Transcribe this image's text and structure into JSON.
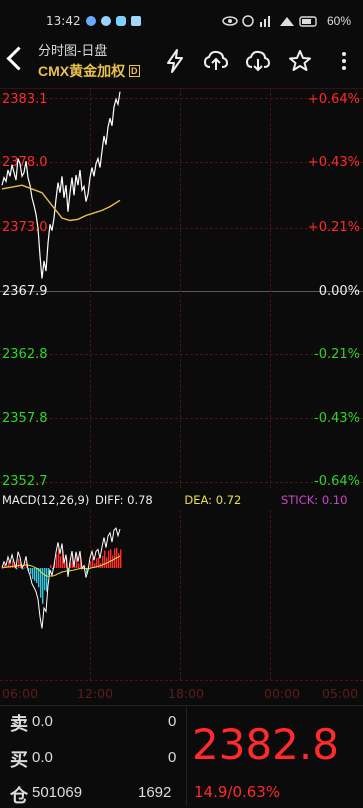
{
  "status_bar": {
    "time": "13:42",
    "battery": "60%",
    "icons": [
      "notification-icon",
      "qq-icon",
      "chat-icon",
      "shield-icon",
      "eye-icon",
      "alarm-icon",
      "signal-icon",
      "wifi-icon",
      "battery-icon"
    ]
  },
  "header": {
    "title_line1": "分时图-日盘",
    "title_line2": "CMX黄金加权",
    "title_badge": "D",
    "icons": [
      "lightning-icon",
      "cloud-upload-icon",
      "cloud-download-icon",
      "star-icon",
      "more-icon"
    ]
  },
  "price_axis": {
    "left": [
      "2383.1",
      "2378.0",
      "2373.0",
      "2367.9",
      "2362.8",
      "2357.8",
      "2352.7"
    ],
    "right": [
      "+0.64%",
      "+0.43%",
      "+0.21%",
      "0.00%",
      "-0.21%",
      "-0.43%",
      "-0.64%"
    ]
  },
  "macd": {
    "label": "MACD(12,26,9)",
    "diff_label": "DIFF:",
    "diff": "0.78",
    "dea_label": "DEA:",
    "dea": "0.72",
    "stick_label": "STICK:",
    "stick": "0.10"
  },
  "time_axis": [
    "06:00",
    "12:00",
    "18:00",
    "00:00",
    "05:00"
  ],
  "quote": {
    "sell_label": "卖",
    "sell_price": "0.0",
    "sell_volume": "0",
    "buy_label": "买",
    "buy_price": "0.0",
    "buy_volume": "0",
    "position_label": "仓",
    "position": "501069",
    "volume": "1692",
    "last_price": "2382.8",
    "change": "14.9/0.63%"
  },
  "colors": {
    "up": "#ff2a2a",
    "down": "#2cd52c",
    "avg_line": "#e9c24b",
    "price_line": "#ffffff",
    "dea": "#e9e24b",
    "stick": "#cc44cc",
    "macd_neg": "#35c8e0"
  },
  "chart_data": {
    "type": "line",
    "y_range": [
      2352.7,
      2383.1
    ],
    "reference_price": 2367.9,
    "series": [
      {
        "x": [
          0,
          1,
          2,
          3,
          4,
          5,
          6,
          7,
          8,
          9,
          10,
          11,
          12,
          13,
          14,
          15,
          16,
          17,
          18,
          19,
          20,
          21,
          22,
          23,
          24,
          25,
          26,
          27,
          28,
          29,
          30,
          31,
          32,
          33,
          34,
          35,
          36,
          37,
          38,
          39,
          40,
          41,
          42,
          43,
          44,
          45,
          46,
          47,
          48,
          49,
          50,
          51,
          52,
          53,
          54,
          55,
          56,
          57,
          58,
          59
        ],
        "values": [
          2376.2,
          2376.8,
          2376.5,
          2377.4,
          2376.9,
          2377.8,
          2377.2,
          2376.6,
          2378.3,
          2377.9,
          2376.9,
          2377.2,
          2378.1,
          2376.8,
          2376.2,
          2375.2,
          2374.6,
          2373.9,
          2372.8,
          2370.6,
          2368.8,
          2370.2,
          2369.4,
          2371.6,
          2373.1,
          2372.6,
          2373.6,
          2375.1,
          2376.4,
          2375.6,
          2376.9,
          2375.2,
          2376.2,
          2374.1,
          2375.6,
          2376.8,
          2375.4,
          2377.0,
          2376.2,
          2377.4,
          2375.8,
          2376.1,
          2374.9,
          2375.5,
          2376.8,
          2377.6,
          2376.9,
          2377.9,
          2378.3,
          2377.6,
          2378.9,
          2380.1,
          2379.4,
          2380.8,
          2381.5,
          2380.9,
          2382.4,
          2383.0,
          2382.6,
          2383.6
        ]
      },
      {
        "x": [
          0,
          10,
          20,
          26,
          30,
          34,
          38,
          42,
          46,
          50,
          54,
          59
        ],
        "values": [
          2375.9,
          2376.2,
          2375.6,
          2374.4,
          2373.6,
          2373.4,
          2373.5,
          2373.8,
          2374.0,
          2374.2,
          2374.5,
          2375.0
        ]
      }
    ]
  }
}
